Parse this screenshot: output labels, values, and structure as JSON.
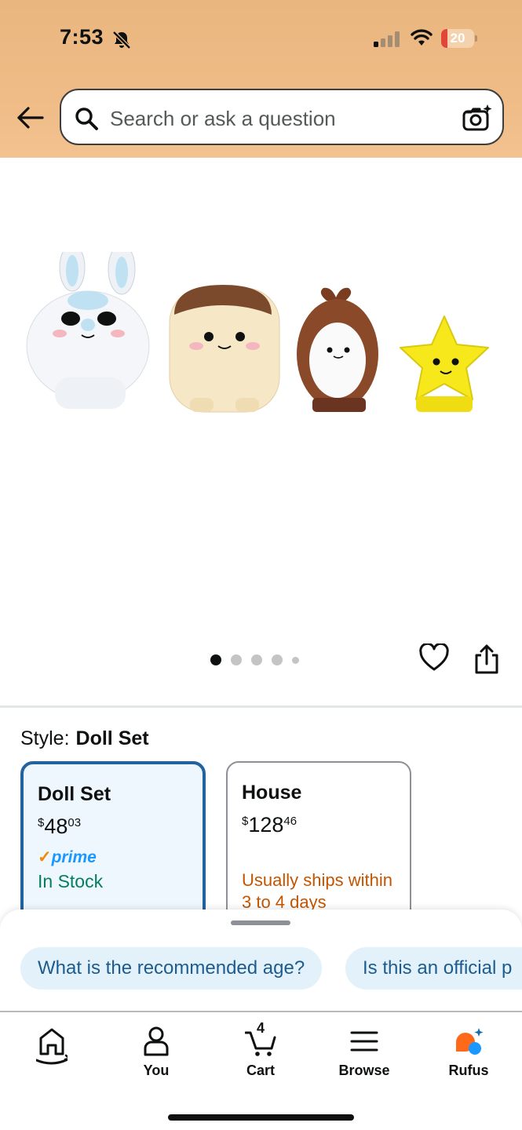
{
  "status_bar": {
    "time": "7:53",
    "battery_level": "20",
    "battery_percent": 20,
    "icons": [
      "bell-slash-icon",
      "cellular-signal-icon",
      "wifi-icon",
      "battery-icon"
    ]
  },
  "header": {
    "back_icon": "arrow-left-icon",
    "search": {
      "placeholder": "Search or ask a question",
      "icon": "search-icon",
      "camera_icon": "camera-sparkle-icon"
    }
  },
  "product_image": {
    "carousel": {
      "count": 5,
      "active_index": 0
    },
    "actions": [
      "heart-icon",
      "share-icon"
    ]
  },
  "style_selector": {
    "label": "Style:",
    "selected_value": "Doll Set",
    "options": [
      {
        "name": "Doll Set",
        "currency": "$",
        "price_whole": "48",
        "price_fraction": "03",
        "prime_label": "prime",
        "availability": "In Stock",
        "selected": true
      },
      {
        "name": "House",
        "currency": "$",
        "price_whole": "128",
        "price_fraction": "46",
        "shipping": "Usually ships within 3 to 4 days",
        "selected": false
      }
    ]
  },
  "rufus_sheet": {
    "suggestions": [
      "What is the recommended age?",
      "Is this an official p"
    ]
  },
  "bottom_nav": {
    "items": [
      {
        "label": "",
        "icon": "home-icon"
      },
      {
        "label": "You",
        "icon": "person-icon"
      },
      {
        "label": "Cart",
        "icon": "cart-icon",
        "count": "4"
      },
      {
        "label": "Browse",
        "icon": "menu-icon"
      },
      {
        "label": "Rufus",
        "icon": "rufus-icon"
      }
    ]
  },
  "colors": {
    "header_bg": "#efbb86",
    "link_blue": "#1d5c8f",
    "selected_border": "#2162a1",
    "in_stock_green": "#067d62",
    "shipping_orange": "#c45500",
    "prime_blue": "#1a98ff"
  }
}
